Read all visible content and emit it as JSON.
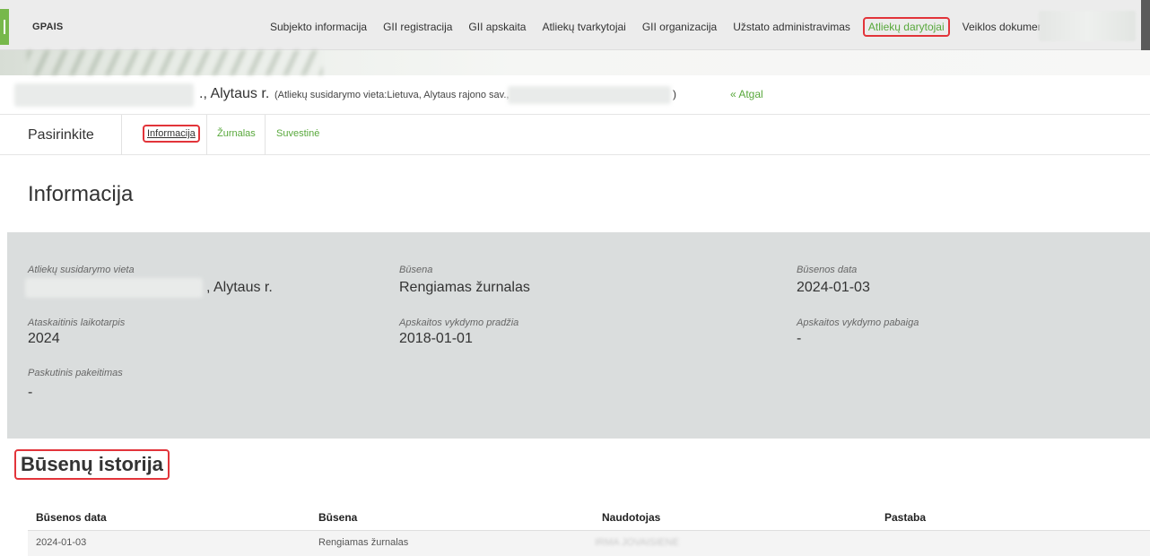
{
  "app": {
    "brand": "GPAIS"
  },
  "nav": {
    "items": [
      {
        "label": "Subjekto informacija"
      },
      {
        "label": "GII registracija"
      },
      {
        "label": "GII apskaita"
      },
      {
        "label": "Atliekų tvarkytojai"
      },
      {
        "label": "GII organizacija"
      },
      {
        "label": "Užstato administravimas"
      },
      {
        "label": "Atliekų darytojai"
      },
      {
        "label": "Veiklos dokumentai"
      }
    ],
    "active_index": 6
  },
  "subject": {
    "town": "., Alytaus r.",
    "place_text": "(Atliekų susidarymo vieta:Lietuva, Alytaus rajono sav.,",
    "close_paren": ")",
    "back_link": "« Atgal"
  },
  "subtabs": {
    "choose_label": "Pasirinkite",
    "items": [
      {
        "label": "Informacija"
      },
      {
        "label": "Žurnalas"
      },
      {
        "label": "Suvestinė"
      }
    ]
  },
  "info": {
    "title": "Informacija",
    "fields": {
      "place": {
        "label": "Atliekų susidarymo vieta",
        "value": ", Alytaus r."
      },
      "status": {
        "label": "Būsena",
        "value": "Rengiamas žurnalas"
      },
      "status_date": {
        "label": "Būsenos data",
        "value": "2024-01-03"
      },
      "period": {
        "label": "Ataskaitinis laikotarpis",
        "value": "2024"
      },
      "start": {
        "label": "Apskaitos vykdymo pradžia",
        "value": "2018-01-01"
      },
      "end": {
        "label": "Apskaitos vykdymo pabaiga",
        "value": "-"
      },
      "last_change": {
        "label": "Paskutinis pakeitimas",
        "value": "-"
      }
    }
  },
  "history": {
    "title": "Būsenų istorija",
    "columns": [
      "Būsenos data",
      "Būsena",
      "Naudotojas",
      "Pastaba"
    ],
    "rows": [
      {
        "date": "2024-01-03",
        "status": "Rengiamas žurnalas",
        "user": "IRMA JOVAISIENE",
        "note": ""
      }
    ]
  },
  "colors": {
    "accent_green": "#58a83b",
    "highlight_red": "#e2343a",
    "panel_gray": "#dadddd"
  }
}
